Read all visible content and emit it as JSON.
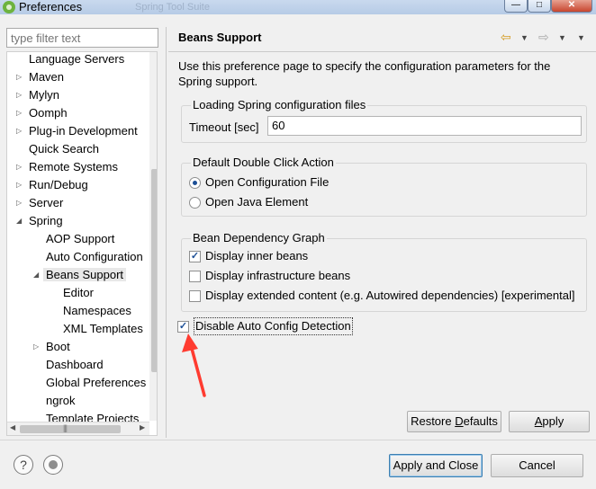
{
  "window": {
    "title": "Preferences",
    "ghost_text": "Spring Tool Suite"
  },
  "filter": {
    "placeholder": "type filter text"
  },
  "tree": [
    {
      "label": "Language Servers",
      "expanded": null
    },
    {
      "label": "Maven",
      "expanded": false
    },
    {
      "label": "Mylyn",
      "expanded": false
    },
    {
      "label": "Oomph",
      "expanded": false
    },
    {
      "label": "Plug-in Development",
      "expanded": false
    },
    {
      "label": "Quick Search",
      "expanded": null
    },
    {
      "label": "Remote Systems",
      "expanded": false
    },
    {
      "label": "Run/Debug",
      "expanded": false
    },
    {
      "label": "Server",
      "expanded": false
    },
    {
      "label": "Spring",
      "expanded": true
    },
    {
      "label": "AOP Support",
      "expanded": null
    },
    {
      "label": "Auto Configuration",
      "expanded": null
    },
    {
      "label": "Beans Support",
      "expanded": true,
      "selected": true
    },
    {
      "label": "Editor",
      "expanded": null
    },
    {
      "label": "Namespaces",
      "expanded": null
    },
    {
      "label": "XML Templates",
      "expanded": null
    },
    {
      "label": "Boot",
      "expanded": false
    },
    {
      "label": "Dashboard",
      "expanded": null
    },
    {
      "label": "Global Preferences",
      "expanded": null
    },
    {
      "label": "ngrok",
      "expanded": null
    },
    {
      "label": "Template Projects",
      "expanded": null
    }
  ],
  "page": {
    "title": "Beans Support",
    "description": "Use this preference page to specify the configuration parameters for the Spring support."
  },
  "loading": {
    "title": "Loading Spring configuration files",
    "timeout_label": "Timeout [sec]",
    "timeout_value": "60"
  },
  "double_click": {
    "title": "Default Double Click Action",
    "options": [
      {
        "label": "Open Configuration File",
        "selected": true
      },
      {
        "label": "Open Java Element",
        "selected": false
      }
    ]
  },
  "graph": {
    "title": "Bean Dependency Graph",
    "options": [
      {
        "label": "Display inner beans",
        "checked": true
      },
      {
        "label": "Display infrastructure beans",
        "checked": false
      },
      {
        "label": "Display extended content (e.g. Autowired dependencies) [experimental]",
        "checked": false
      }
    ]
  },
  "auto_config": {
    "label": "Disable Auto Config Detection",
    "checked": true
  },
  "buttons": {
    "restore_defaults": "Restore Defaults",
    "apply": "Apply",
    "apply_and_close": "Apply and Close",
    "cancel": "Cancel"
  },
  "colors": {
    "annotation_arrow": "#ff3b30",
    "accent": "#1c4f96"
  }
}
